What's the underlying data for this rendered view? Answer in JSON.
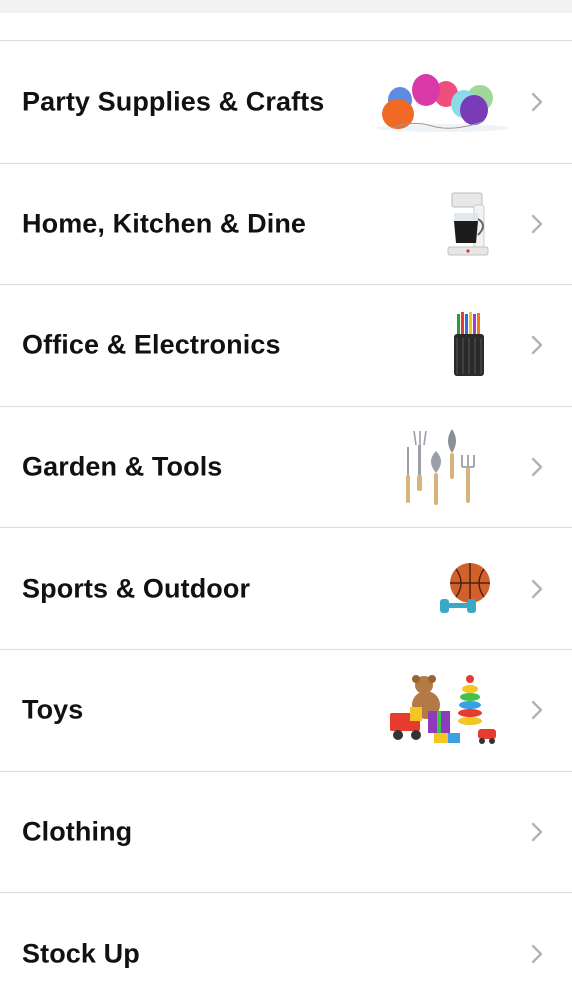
{
  "categories": [
    {
      "label": "Party Supplies & Crafts",
      "icon": "balloons-icon"
    },
    {
      "label": "Home, Kitchen & Dine",
      "icon": "coffee-maker-icon"
    },
    {
      "label": "Office & Electronics",
      "icon": "pencil-cup-icon"
    },
    {
      "label": "Garden & Tools",
      "icon": "garden-tools-icon"
    },
    {
      "label": "Sports & Outdoor",
      "icon": "basketball-dumbbell-icon"
    },
    {
      "label": "Toys",
      "icon": "toys-icon"
    },
    {
      "label": "Clothing",
      "icon": null
    },
    {
      "label": "Stock Up",
      "icon": null
    }
  ],
  "colors": {
    "separator": "#dcdcdc",
    "chevron": "#b3b3b3",
    "text": "#111111",
    "header_gray": "#f2f2f2"
  }
}
